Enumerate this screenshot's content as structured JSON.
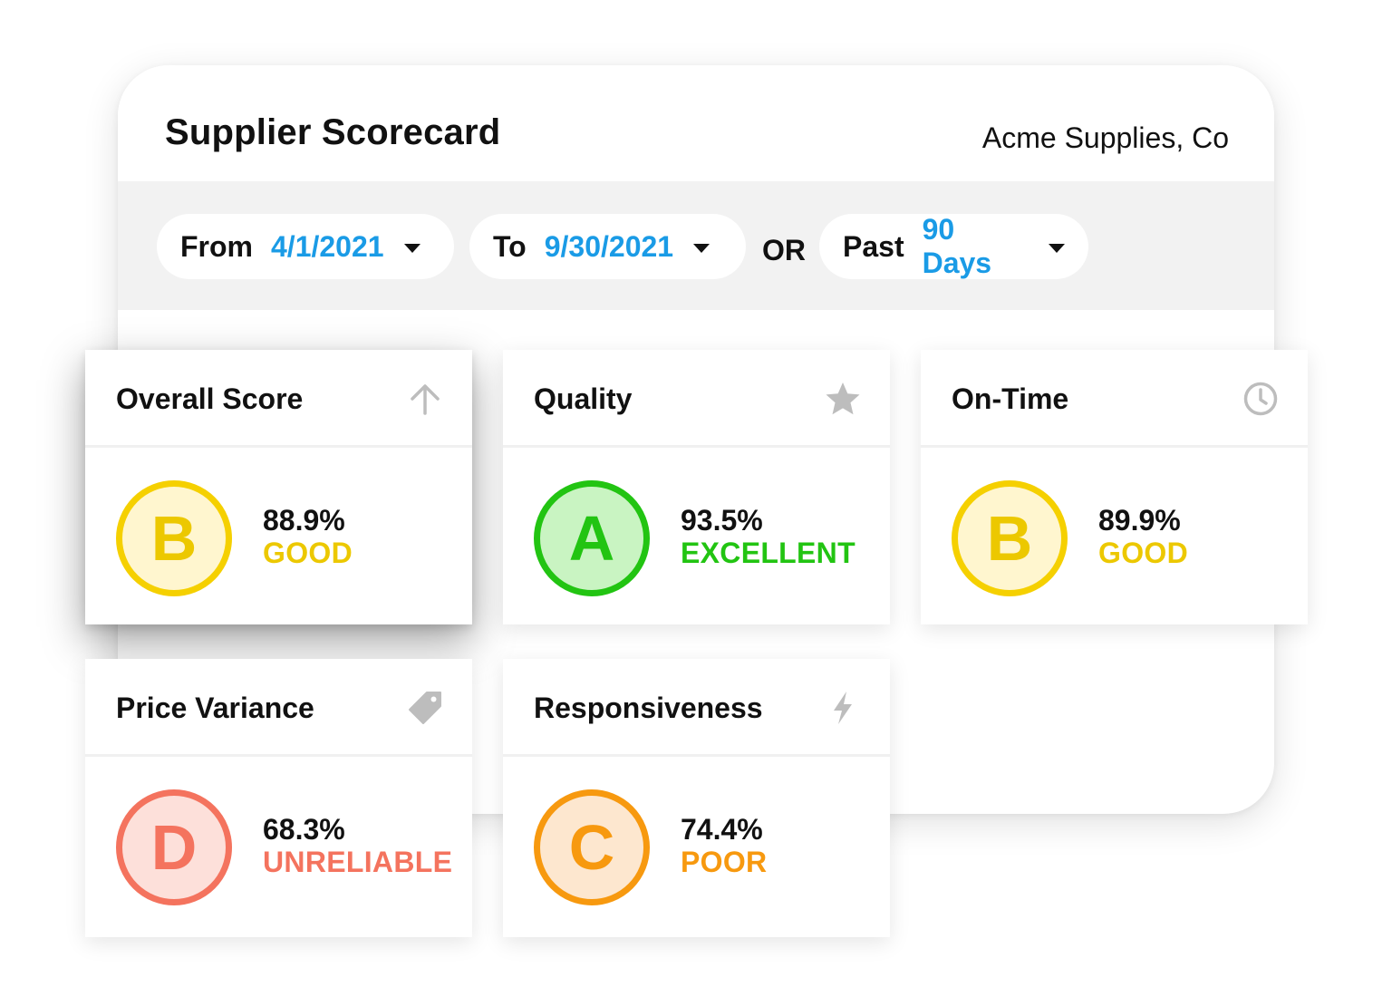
{
  "header": {
    "title": "Supplier Scorecard",
    "supplier": "Acme Supplies, Co"
  },
  "filters": {
    "from": {
      "label": "From",
      "value": "4/1/2021"
    },
    "to": {
      "label": "To",
      "value": "9/30/2021"
    },
    "or_label": "OR",
    "past": {
      "label": "Past",
      "value": "90 Days"
    }
  },
  "cards": [
    {
      "title": "Overall Score",
      "icon": "arrow-up-icon",
      "grade": "B",
      "percent": "88.9%",
      "rating": "GOOD",
      "color": "#f5d000",
      "fill": "#fff6cf",
      "text_color": "#ecc800"
    },
    {
      "title": "Quality",
      "icon": "star-icon",
      "grade": "A",
      "percent": "93.5%",
      "rating": "EXCELLENT",
      "color": "#22c412",
      "fill": "#c9f4c2",
      "text_color": "#22c412"
    },
    {
      "title": "On-Time",
      "icon": "clock-icon",
      "grade": "B",
      "percent": "89.9%",
      "rating": "GOOD",
      "color": "#f5d000",
      "fill": "#fff6cf",
      "text_color": "#ecc800"
    },
    {
      "title": "Price Variance",
      "icon": "tag-icon",
      "grade": "D",
      "percent": "68.3%",
      "rating": "UNRELIABLE",
      "color": "#f4735e",
      "fill": "#fde0da",
      "text_color": "#f4735e"
    },
    {
      "title": "Responsiveness",
      "icon": "lightning-icon",
      "grade": "C",
      "percent": "74.4%",
      "rating": "POOR",
      "color": "#f7990f",
      "fill": "#fde7cf",
      "text_color": "#f7990f"
    }
  ]
}
